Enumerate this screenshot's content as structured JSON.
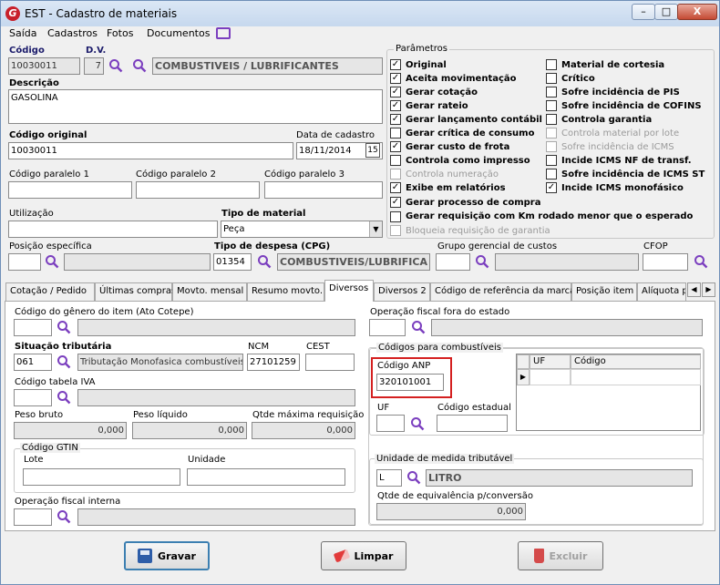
{
  "window": {
    "title": "EST - Cadastro de materiais",
    "app_icon_letter": "G",
    "minimize": "–",
    "maximize": "□",
    "close": "X"
  },
  "menu": [
    "Saída",
    "Cadastros",
    "Fotos",
    "Documentos"
  ],
  "header": {
    "codigo_label": "Código",
    "codigo_value": "10030011",
    "dv_label": "D.V.",
    "dv_value": "7",
    "grupo_value": "COMBUSTIVEIS / LUBRIFICANTES",
    "descricao_label": "Descrição",
    "descricao_value": "GASOLINA",
    "codigo_original_label": "Código original",
    "codigo_original_value": "10030011",
    "data_cadastro_label": "Data de cadastro",
    "data_cadastro_value": "18/11/2014",
    "date_btn": "15",
    "cod_paralelo1_label": "Código paralelo 1",
    "cod_paralelo2_label": "Código paralelo 2",
    "cod_paralelo3_label": "Código paralelo 3",
    "utilizacao_label": "Utilização",
    "tipo_material_label": "Tipo de material",
    "tipo_material_value": "Peça",
    "posicao_label": "Posição específica",
    "tipo_despesa_label": "Tipo de despesa (CPG)",
    "tipo_despesa_code": "01354",
    "tipo_despesa_desc": "COMBUSTIVEIS/LUBRIFICA",
    "grupo_gerencial_label": "Grupo gerencial de custos",
    "cfop_label": "CFOP"
  },
  "parametros": {
    "title": "Parâmetros",
    "left": [
      {
        "label": "Original",
        "checked": true,
        "enabled": true
      },
      {
        "label": "Aceita movimentação",
        "checked": true,
        "enabled": true
      },
      {
        "label": "Gerar cotação",
        "checked": true,
        "enabled": true
      },
      {
        "label": "Gerar rateio",
        "checked": true,
        "enabled": true
      },
      {
        "label": "Gerar lançamento contábil",
        "checked": true,
        "enabled": true
      },
      {
        "label": "Gerar crítica de consumo",
        "checked": false,
        "enabled": true
      },
      {
        "label": "Gerar custo de frota",
        "checked": true,
        "enabled": true
      },
      {
        "label": "Controla como impresso",
        "checked": false,
        "enabled": true
      },
      {
        "label": "Controla numeração",
        "checked": false,
        "enabled": false
      },
      {
        "label": "Exibe em relatórios",
        "checked": true,
        "enabled": true
      }
    ],
    "right": [
      {
        "label": "Material de cortesia",
        "checked": false,
        "enabled": true
      },
      {
        "label": "Crítico",
        "checked": false,
        "enabled": true
      },
      {
        "label": "Sofre incidência de PIS",
        "checked": false,
        "enabled": true
      },
      {
        "label": "Sofre incidência de COFINS",
        "checked": false,
        "enabled": true
      },
      {
        "label": "Controla garantia",
        "checked": false,
        "enabled": true
      },
      {
        "label": "Controla material por lote",
        "checked": false,
        "enabled": false
      },
      {
        "label": "Sofre incidência de ICMS",
        "checked": false,
        "enabled": false
      },
      {
        "label": "Incide ICMS NF de transf.",
        "checked": false,
        "enabled": true
      },
      {
        "label": "Sofre incidência de ICMS ST",
        "checked": false,
        "enabled": true
      },
      {
        "label": "Incide ICMS monofásico",
        "checked": true,
        "enabled": true
      }
    ],
    "bottom": [
      {
        "label": "Gerar processo de compra",
        "checked": true,
        "enabled": true
      },
      {
        "label": "Gerar requisição com Km rodado menor que o esperado",
        "checked": false,
        "enabled": true
      },
      {
        "label": "Bloqueia requisição de garantia",
        "checked": false,
        "enabled": false
      }
    ]
  },
  "tabs": [
    "Cotação / Pedido",
    "Últimas compras",
    "Movto. mensal",
    "Resumo movto.",
    "Diversos",
    "Diversos 2",
    "Código de referência da marca",
    "Posição item",
    "Alíquota p"
  ],
  "tab_scroll": {
    "left": "◀",
    "right": "▶"
  },
  "diversos": {
    "genero_label": "Código do gênero do item (Ato Cotepe)",
    "op_fiscal_fora_label": "Operação fiscal fora do estado",
    "sit_trib_label": "Situação tributária",
    "sit_trib_code": "061",
    "sit_trib_desc": "Tributação Monofasica combustíveis",
    "ncm_label": "NCM",
    "ncm_value": "27101259",
    "cest_label": "CEST",
    "iva_label": "Código tabela IVA",
    "peso_bruto_label": "Peso bruto",
    "peso_bruto_value": "0,000",
    "peso_liquido_label": "Peso líquido",
    "peso_liquido_value": "0,000",
    "qtde_max_label": "Qtde máxima requisição",
    "qtde_max_value": "0,000",
    "gtin_title": "Código GTIN",
    "lote_label": "Lote",
    "unidade_label": "Unidade",
    "op_fiscal_int_label": "Operação fiscal interna",
    "combustiveis_title": "Códigos para combustíveis",
    "anp_label": "Código ANP",
    "anp_value": "320101001",
    "uf_label": "UF",
    "cod_estadual_label": "Código estadual",
    "grid_uf": "UF",
    "grid_codigo": "Código",
    "unidade_trib_title": "Unidade de medida tributável",
    "unidade_trib_code": "L",
    "unidade_trib_desc": "LITRO",
    "qtde_equiv_label": "Qtde de equivalência p/conversão",
    "qtde_equiv_value": "0,000"
  },
  "buttons": {
    "gravar": "Gravar",
    "limpar": "Limpar",
    "excluir": "Excluir"
  },
  "colors": {
    "highlight_red": "#d42020",
    "accent_purple": "#7b3fbf",
    "title_bg": "#c6d8ee"
  }
}
